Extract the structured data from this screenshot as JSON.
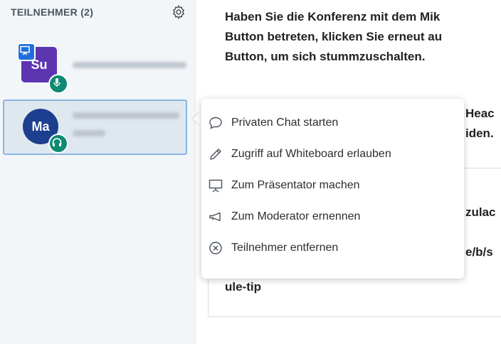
{
  "sidebar": {
    "header": "TEILNEHMER (2)",
    "users": [
      {
        "initials": "Su",
        "name_blurred": true,
        "presenter": true,
        "audio": "mic"
      },
      {
        "initials": "Ma",
        "name_blurred": true,
        "presenter": false,
        "audio": "listen-only"
      }
    ]
  },
  "main": {
    "lines": [
      "Haben Sie die Konferenz mit dem Mik",
      "Button betreten, klicken Sie erneut au",
      "Button, um sich stummzuschalten."
    ],
    "fragments": [
      "Heac",
      "iden.",
      "zulac",
      "e/b/s",
      "ule-tip"
    ]
  },
  "menu": {
    "items": [
      {
        "label": "Privaten Chat starten",
        "icon": "chat-bubble-icon"
      },
      {
        "label": "Zugriff auf Whiteboard erlauben",
        "icon": "pencil-icon"
      },
      {
        "label": "Zum Präsentator machen",
        "icon": "presentation-board-icon"
      },
      {
        "label": "Zum Moderator ernennen",
        "icon": "megaphone-icon"
      },
      {
        "label": "Teilnehmer entfernen",
        "icon": "close-circle-icon"
      }
    ]
  },
  "colors": {
    "sidebar_bg": "#f3f6f9",
    "avatar_su": "#5e35b1",
    "avatar_ma": "#1d3f90",
    "audio_badge": "#0f8a72",
    "presenter_badge": "#1f6ee0",
    "selection_border": "#8ab4e4"
  }
}
